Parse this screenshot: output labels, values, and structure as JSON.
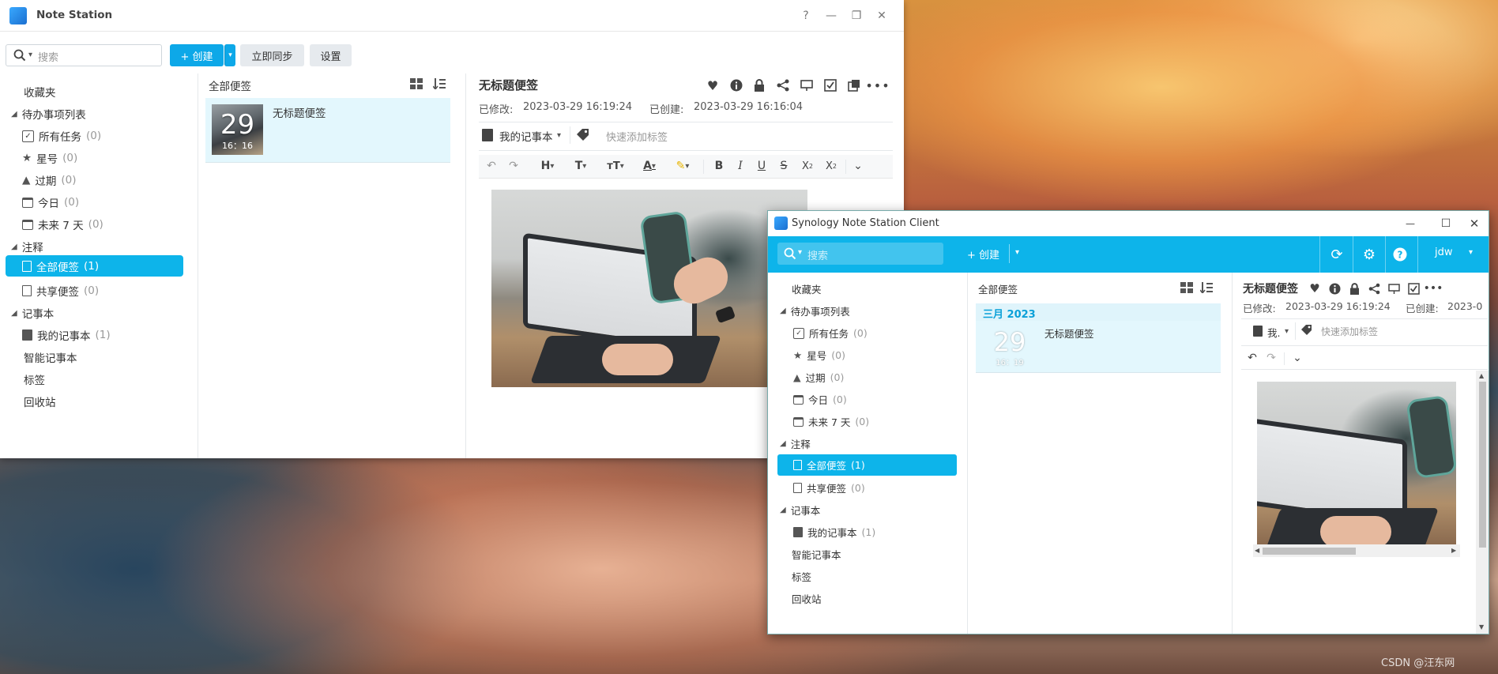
{
  "window1": {
    "title": "Note Station",
    "controls": {
      "help": "?",
      "minimize": "—",
      "maximize": "❐",
      "close": "✕"
    },
    "search_placeholder": "搜索",
    "create_label": "+ 创建",
    "sync_label": "立即同步",
    "settings_label": "设置",
    "sidebar": {
      "favorites": "收藏夹",
      "todo_header": "待办事项列表",
      "todo_items": [
        {
          "label": "所有任务",
          "count": "(0)",
          "icon": "checkbox-icon"
        },
        {
          "label": "星号",
          "count": "(0)",
          "icon": "star-icon"
        },
        {
          "label": "过期",
          "count": "(0)",
          "icon": "warning-icon"
        },
        {
          "label": "今日",
          "count": "(0)",
          "icon": "calendar-icon"
        },
        {
          "label": "未来 7 天",
          "count": "(0)",
          "icon": "calendar-week-icon"
        }
      ],
      "notes_header": "注释",
      "notes_items": [
        {
          "label": "全部便签",
          "count": "(1)",
          "selected": true
        },
        {
          "label": "共享便签",
          "count": "(0)"
        }
      ],
      "notebooks_header": "记事本",
      "notebook_items": [
        {
          "label": "我的记事本",
          "count": "(1)"
        }
      ],
      "smart_notebooks": "智能记事本",
      "tags": "标签",
      "trash": "回收站"
    },
    "list": {
      "header": "全部便签",
      "note_title": "无标题便签",
      "thumb_day": "29",
      "thumb_time": "16：16"
    },
    "editor": {
      "title": "无标题便签",
      "modified_label": "已修改:",
      "modified_value": "2023-03-29 16:19:24",
      "created_label": "已创建:",
      "created_value": "2023-03-29 16:16:04",
      "notebook": "我的记事本",
      "tag_placeholder": "快速添加标签"
    }
  },
  "window2": {
    "title": "Synology Note Station Client",
    "controls": {
      "minimize": "—",
      "maximize": "☐",
      "close": "✕"
    },
    "search_placeholder": "搜索",
    "create_label": "+ 创建",
    "user": "jdw",
    "sidebar": {
      "favorites": "收藏夹",
      "todo_header": "待办事项列表",
      "todo_items": [
        {
          "label": "所有任务",
          "count": "(0)"
        },
        {
          "label": "星号",
          "count": "(0)"
        },
        {
          "label": "过期",
          "count": "(0)"
        },
        {
          "label": "今日",
          "count": "(0)"
        },
        {
          "label": "未来 7 天",
          "count": "(0)"
        }
      ],
      "notes_header": "注释",
      "notes_items": [
        {
          "label": "全部便签",
          "count": "(1)",
          "selected": true
        },
        {
          "label": "共享便签",
          "count": "(0)"
        }
      ],
      "notebooks_header": "记事本",
      "notebook_items": [
        {
          "label": "我的记事本",
          "count": "(1)"
        }
      ],
      "smart_notebooks": "智能记事本",
      "tags": "标签",
      "trash": "回收站"
    },
    "list": {
      "header": "全部便签",
      "month": "三月 2023",
      "note_title": "无标题便签",
      "thumb_day": "29",
      "thumb_time": "16：19"
    },
    "editor": {
      "title": "无标题便签",
      "modified_label": "已修改:",
      "modified_value": "2023-03-29 16:19:24",
      "created_label": "已创建:",
      "created_value": "2023-0",
      "notebook": "我.",
      "tag_placeholder": "快速添加标签"
    }
  },
  "watermark": "CSDN @汪东网"
}
